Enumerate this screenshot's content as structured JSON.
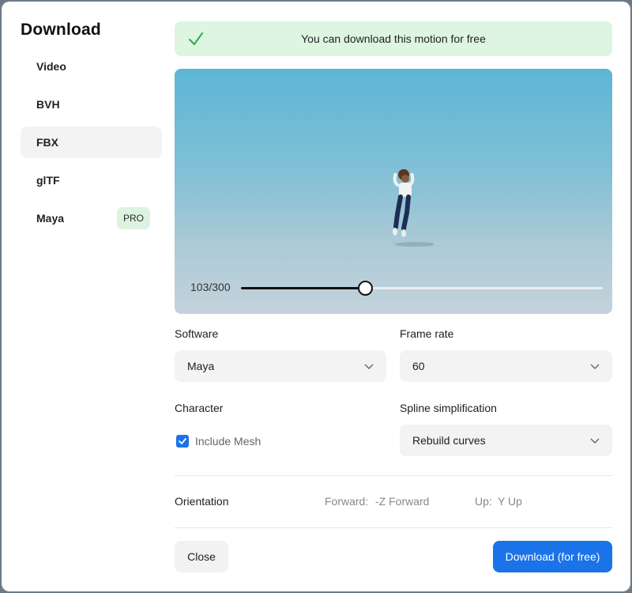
{
  "dialog": {
    "title": "Download",
    "banner_text": "You can download this motion for free"
  },
  "sidebar": {
    "items": [
      {
        "label": "Video"
      },
      {
        "label": "BVH"
      },
      {
        "label": "FBX",
        "active": true
      },
      {
        "label": "glTF"
      },
      {
        "label": "Maya",
        "badge": "PRO"
      }
    ]
  },
  "preview": {
    "frame_counter": "103/300",
    "current_frame": 103,
    "total_frames": 300
  },
  "form": {
    "software": {
      "label": "Software",
      "value": "Maya"
    },
    "frame_rate": {
      "label": "Frame rate",
      "value": "60"
    },
    "character": {
      "label": "Character",
      "include_mesh_label": "Include Mesh",
      "include_mesh_checked": true
    },
    "spline": {
      "label": "Spline simplification",
      "value": "Rebuild curves"
    },
    "orientation": {
      "label": "Orientation",
      "forward_key": "Forward:",
      "forward_value": "-Z Forward",
      "up_key": "Up:",
      "up_value": "Y Up"
    }
  },
  "actions": {
    "close_label": "Close",
    "download_label": "Download (for free)"
  },
  "colors": {
    "accent": "#1a73e8",
    "success_bg": "#ddf5e1",
    "success_icon": "#2eaa4f"
  }
}
